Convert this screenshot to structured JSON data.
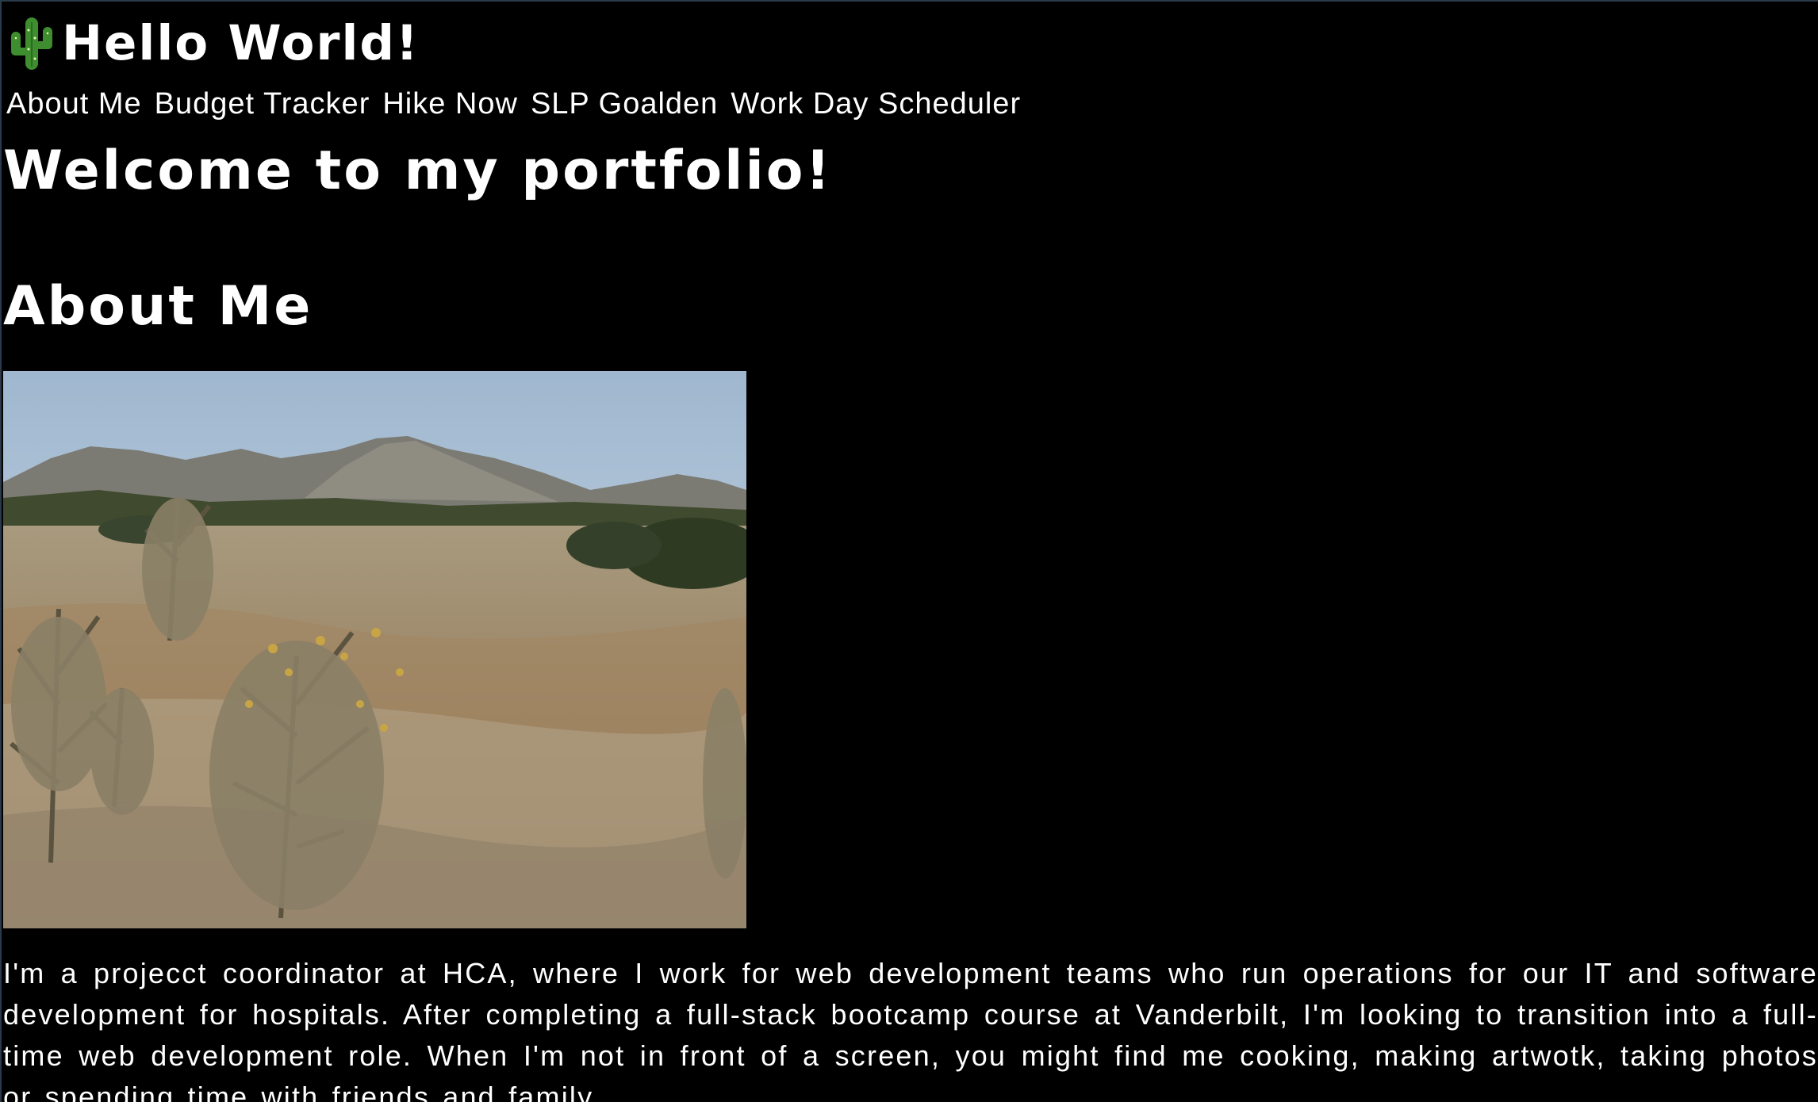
{
  "header": {
    "title": "Hello World!",
    "icon": "cactus-icon"
  },
  "nav": {
    "items": [
      {
        "label": "About Me"
      },
      {
        "label": "Budget Tracker"
      },
      {
        "label": "Hike Now"
      },
      {
        "label": "SLP Goalden"
      },
      {
        "label": "Work Day Scheduler"
      }
    ]
  },
  "main": {
    "welcome_heading": "Welcome to my portfolio!",
    "about_heading": "About Me",
    "bio": "I'm a projecct coordinator at HCA, where I work for web development teams who run operations for our IT and software development for hospitals. After completing a full-stack bootcamp course at Vanderbilt, I'm looking to transition into a full-time web development role. When I'm not in front of a screen, you might find me cooking, making artwotk, taking photos or spending time with friends and family."
  },
  "colors": {
    "background": "#000000",
    "text": "#ffffff"
  }
}
